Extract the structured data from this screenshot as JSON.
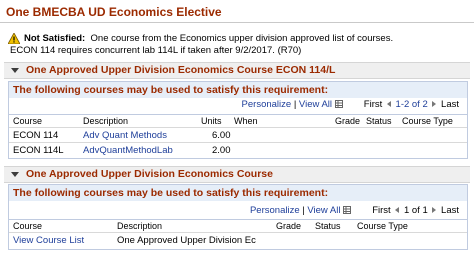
{
  "header": {
    "title": "One BMECBA UD Economics Elective"
  },
  "status": {
    "label": "Not Satisfied:",
    "text": "One course from the Economics upper division approved list of courses.",
    "note": "ECON 114 requires concurrent lab 114L if taken after 9/2/2017. (R70)"
  },
  "sections": [
    {
      "title": "One Approved Upper Division Economics Course ECON 114/L",
      "caption": "The following courses may be used to satisfy this requirement:",
      "nav": {
        "personalize": "Personalize",
        "separator": "|",
        "view_all": "View All",
        "first": "First",
        "range": "1-2 of 2",
        "last": "Last"
      },
      "columns": [
        "Course",
        "Description",
        "Units",
        "When",
        "Grade",
        "Status",
        "Course Type"
      ],
      "rows": [
        {
          "course": "ECON 114",
          "description": "Adv Quant Methods",
          "units": "6.00"
        },
        {
          "course": "ECON 114L",
          "description": "AdvQuantMethodLab",
          "units": "2.00"
        }
      ]
    },
    {
      "title": "One Approved Upper Division Economics Course",
      "caption": "The following courses may be used to satisfy this requirement:",
      "nav": {
        "personalize": "Personalize",
        "separator": "|",
        "view_all": "View All",
        "first": "First",
        "range": "1 of 1",
        "last": "Last"
      },
      "columns": [
        "Course",
        "Description",
        "Grade",
        "Status",
        "Course Type"
      ],
      "rows": [
        {
          "course": "View Course List",
          "description": "One Approved Upper Division Ec"
        }
      ]
    }
  ],
  "colors": {
    "title": "#9b2a00",
    "link": "#1f3f9a",
    "caption_bg": "#e6eef8",
    "section_bg": "#efefef"
  },
  "icons": [
    "warning-icon",
    "collapse-triangle-icon",
    "grid-icon",
    "first-arrow-icon",
    "last-arrow-icon"
  ]
}
